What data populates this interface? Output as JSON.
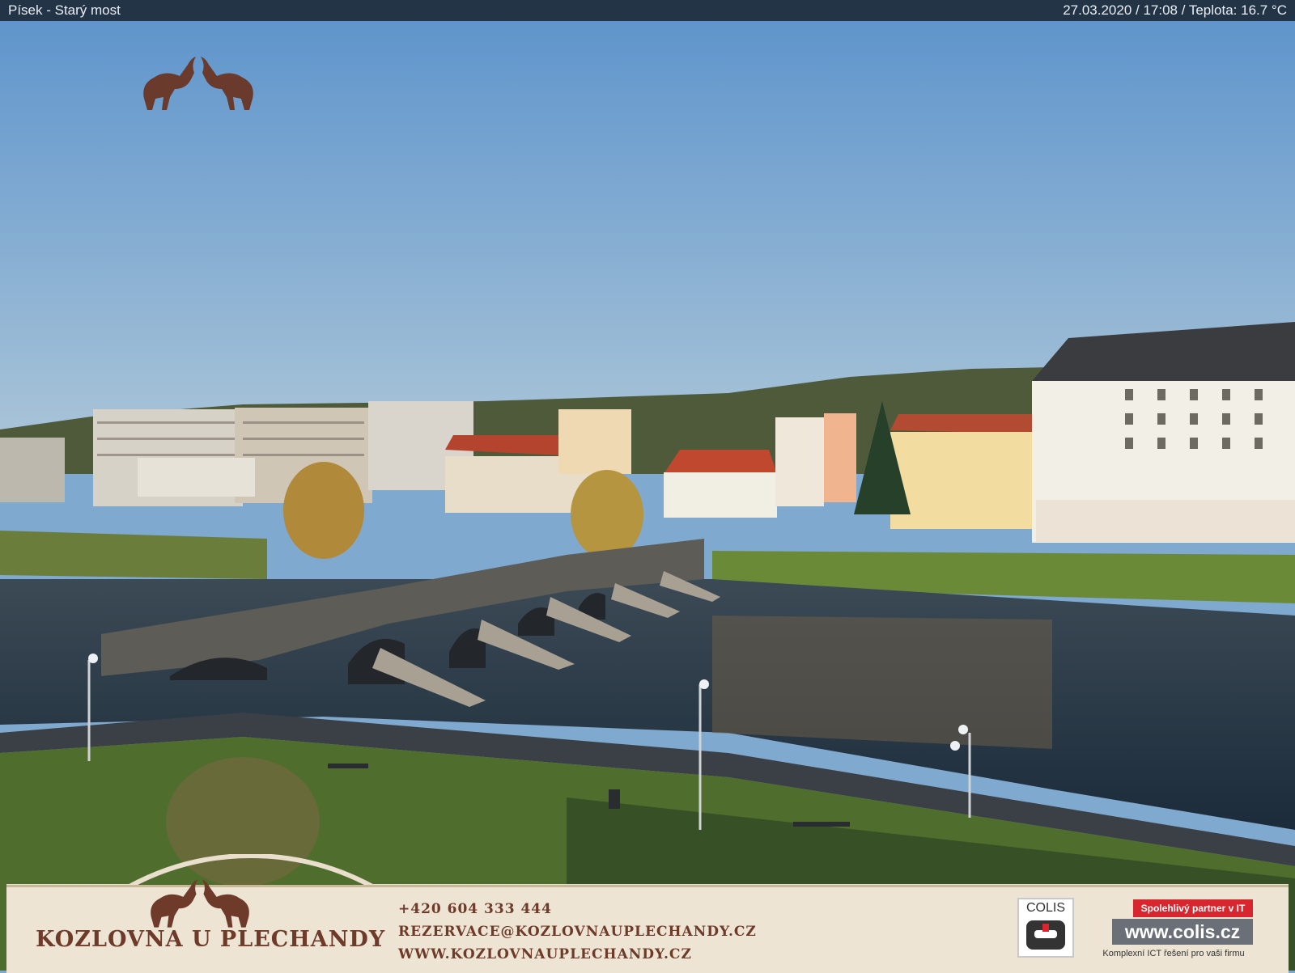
{
  "topbar": {
    "location": "Písek - Starý most",
    "status": "27.03.2020 / 17:08 / Teplota: 16.7 °C"
  },
  "scene": {
    "description_icon": "webcam-landscape",
    "colors": {
      "sky": "#7fa9cf",
      "river": "#1f3346",
      "grass": "#5a7a32"
    }
  },
  "footer": {
    "brand": "KOZLOVNA U PLECHANDY",
    "phone": "+420 604 333 444",
    "email": "REZERVACE@KOZLOVNAUPLECHANDY.CZ",
    "website": "WWW.KOZLOVNAUPLECHANDY.CZ",
    "sponsor": {
      "name": "COLIS",
      "badge": "Spolehlivý partner v IT",
      "url": "www.colis.cz",
      "tagline": "Komplexní ICT řešení pro vaši firmu"
    }
  }
}
